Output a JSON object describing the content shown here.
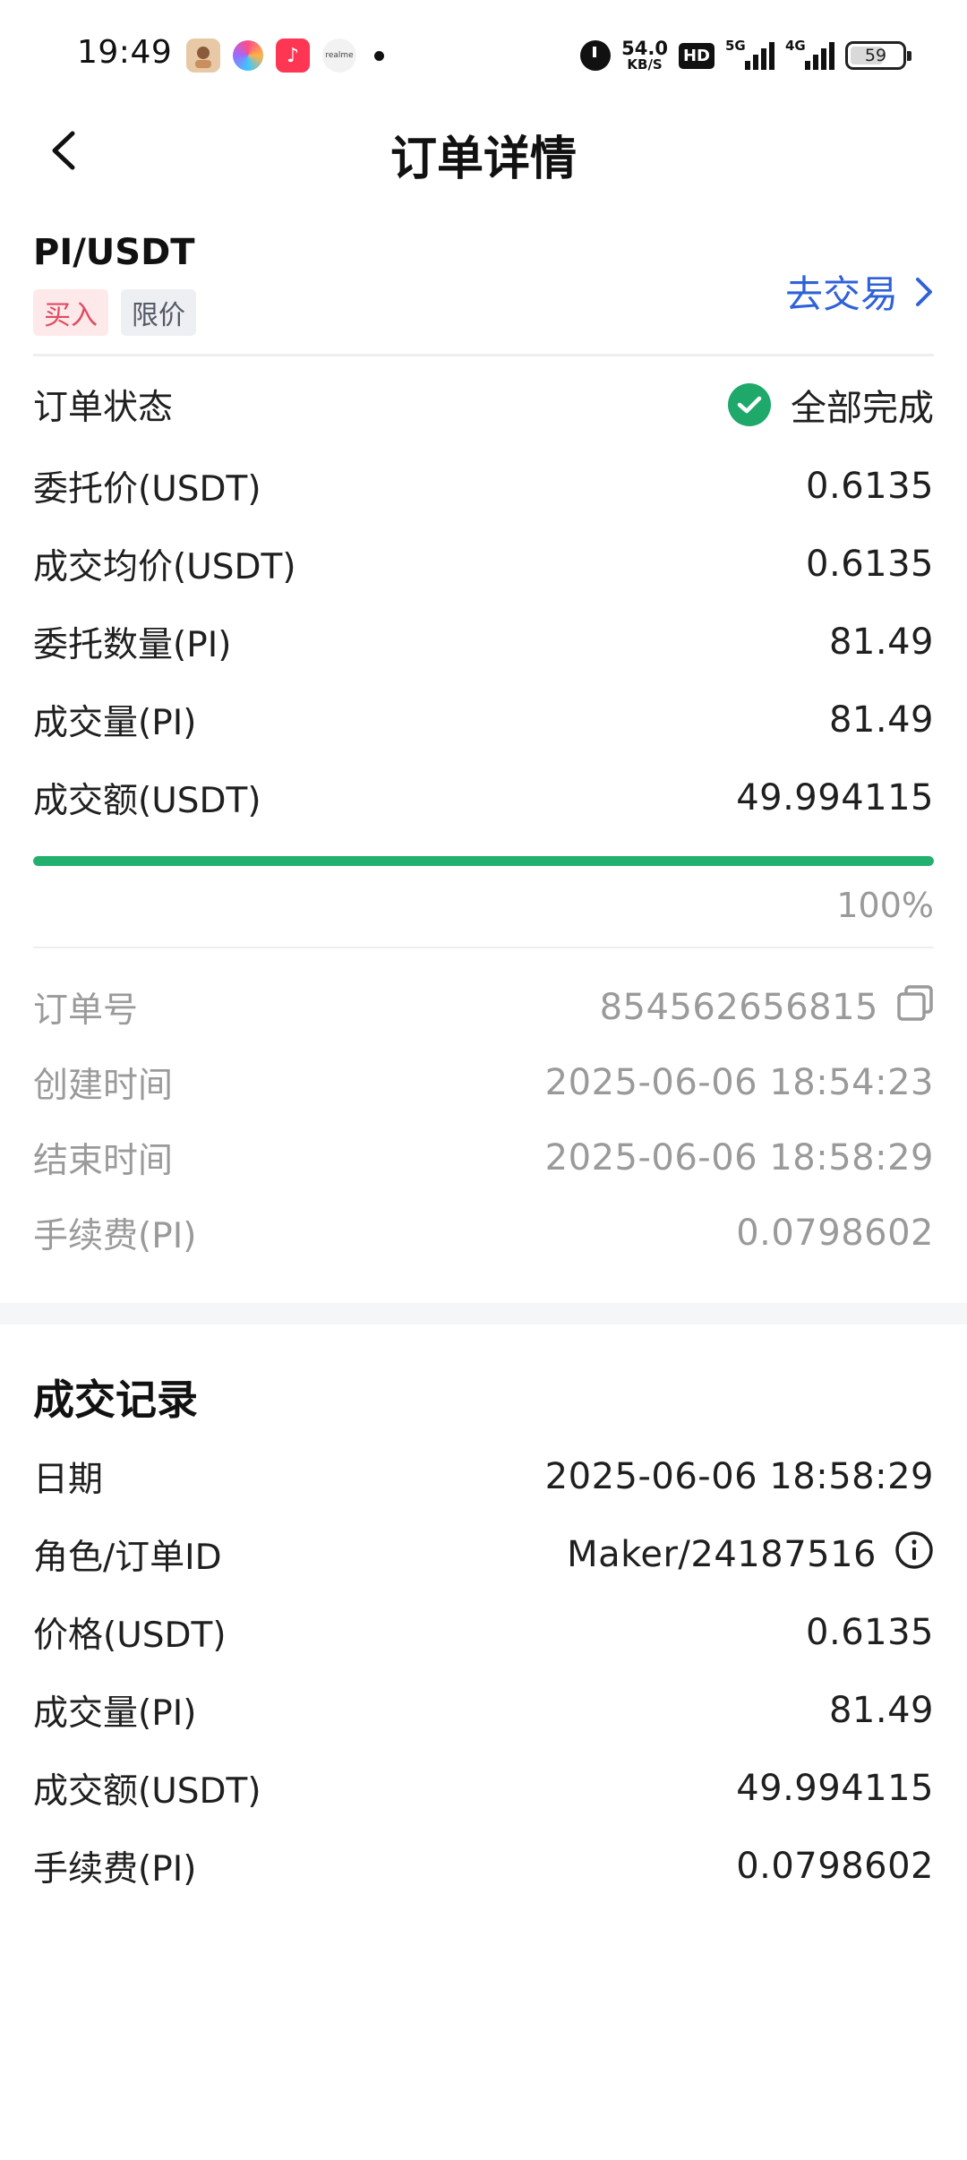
{
  "status_bar": {
    "time": "19:49",
    "notification_icons": [
      "avatar-icon",
      "colorful-app-icon",
      "music-icon",
      "realme-icon"
    ],
    "realme_label": "realme",
    "net_speed_value": "54.0",
    "net_speed_unit": "KB/S",
    "hd_label": "HD",
    "signal1_tag": "5G",
    "signal2_tag": "4G",
    "battery": "59"
  },
  "header": {
    "title": "订单详情",
    "back_icon": "chevron-left-icon"
  },
  "pair": {
    "name": "PI/USDT",
    "side_tag": "买入",
    "type_tag": "限价",
    "trade_link": "去交易"
  },
  "order": {
    "status_label": "订单状态",
    "status_value": "全部完成",
    "price_label": "委托价(USDT)",
    "price_value": "0.6135",
    "avg_price_label": "成交均价(USDT)",
    "avg_price_value": "0.6135",
    "amount_label": "委托数量(PI)",
    "amount_value": "81.49",
    "filled_label": "成交量(PI)",
    "filled_value": "81.49",
    "total_label": "成交额(USDT)",
    "total_value": "49.994115",
    "progress_percent": 100,
    "progress_text": "100%"
  },
  "meta": {
    "order_no_label": "订单号",
    "order_no_value": "854562656815",
    "created_label": "创建时间",
    "created_value": "2025-06-06 18:54:23",
    "ended_label": "结束时间",
    "ended_value": "2025-06-06 18:58:29",
    "fee_label": "手续费(PI)",
    "fee_value": "0.0798602"
  },
  "records": {
    "title": "成交记录",
    "date_label": "日期",
    "date_value": "2025-06-06 18:58:29",
    "role_label": "角色/订单ID",
    "role_value": "Maker/24187516",
    "price_label": "价格(USDT)",
    "price_value": "0.6135",
    "filled_label": "成交量(PI)",
    "filled_value": "81.49",
    "total_label": "成交额(USDT)",
    "total_value": "49.994115",
    "fee_label": "手续费(PI)",
    "fee_value": "0.0798602"
  },
  "colors": {
    "accent_blue": "#2f62d8",
    "success_green": "#22b06e",
    "buy_red": "#e04b5f"
  }
}
